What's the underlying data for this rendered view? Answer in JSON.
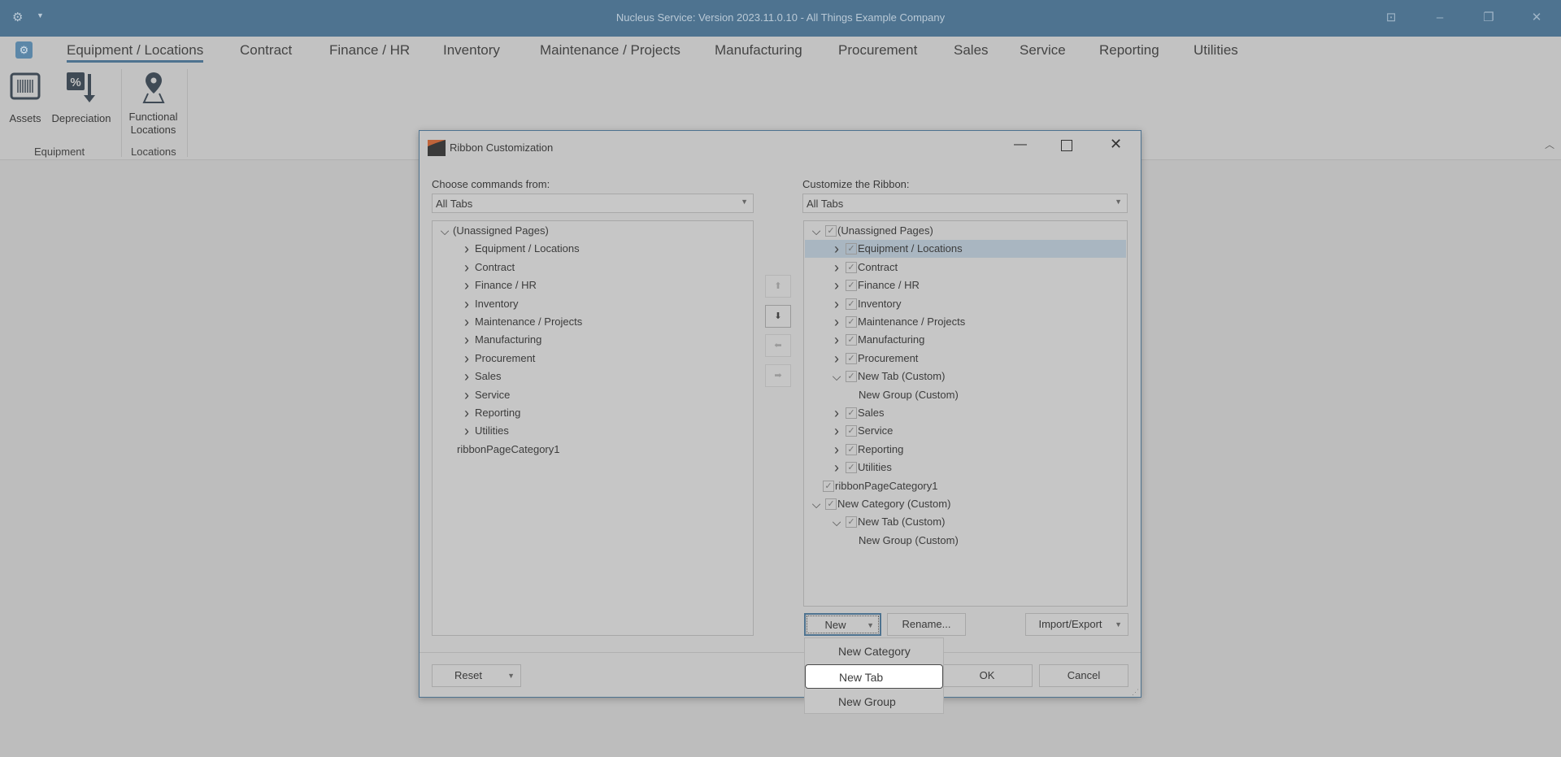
{
  "app": {
    "title": "Nucleus Service: Version 2023.11.0.10 - All Things Example Company"
  },
  "tabs": [
    "Equipment / Locations",
    "Contract",
    "Finance / HR",
    "Inventory",
    "Maintenance / Projects",
    "Manufacturing",
    "Procurement",
    "Sales",
    "Service",
    "Reporting",
    "Utilities"
  ],
  "ribbon": {
    "assets": "Assets",
    "depreciation": "Depreciation",
    "functional_locations": "Functional Locations",
    "group_equipment": "Equipment",
    "group_locations": "Locations"
  },
  "dialog": {
    "title": "Ribbon Customization",
    "left_label": "Choose commands from:",
    "left_combo": "All Tabs",
    "right_label": "Customize the Ribbon:",
    "right_combo": "All Tabs",
    "left_tree": [
      {
        "label": "(Unassigned Pages)",
        "level": 0,
        "chevron": "down"
      },
      {
        "label": "Equipment / Locations",
        "level": 1,
        "chevron": "right"
      },
      {
        "label": "Contract",
        "level": 1,
        "chevron": "right"
      },
      {
        "label": "Finance / HR",
        "level": 1,
        "chevron": "right"
      },
      {
        "label": "Inventory",
        "level": 1,
        "chevron": "right"
      },
      {
        "label": "Maintenance / Projects",
        "level": 1,
        "chevron": "right"
      },
      {
        "label": "Manufacturing",
        "level": 1,
        "chevron": "right"
      },
      {
        "label": "Procurement",
        "level": 1,
        "chevron": "right"
      },
      {
        "label": "Sales",
        "level": 1,
        "chevron": "right"
      },
      {
        "label": "Service",
        "level": 1,
        "chevron": "right"
      },
      {
        "label": "Reporting",
        "level": 1,
        "chevron": "right"
      },
      {
        "label": "Utilities",
        "level": 1,
        "chevron": "right"
      },
      {
        "label": "ribbonPageCategory1",
        "level": 1,
        "chevron": ""
      }
    ],
    "right_tree": [
      {
        "label": "(Unassigned Pages)",
        "level": 0,
        "chevron": "down",
        "checked": true
      },
      {
        "label": "Equipment / Locations",
        "level": 1,
        "chevron": "right",
        "checked": true,
        "selected": true
      },
      {
        "label": "Contract",
        "level": 1,
        "chevron": "right",
        "checked": true
      },
      {
        "label": "Finance / HR",
        "level": 1,
        "chevron": "right",
        "checked": true
      },
      {
        "label": "Inventory",
        "level": 1,
        "chevron": "right",
        "checked": true
      },
      {
        "label": "Maintenance / Projects",
        "level": 1,
        "chevron": "right",
        "checked": true
      },
      {
        "label": "Manufacturing",
        "level": 1,
        "chevron": "right",
        "checked": true
      },
      {
        "label": "Procurement",
        "level": 1,
        "chevron": "right",
        "checked": true
      },
      {
        "label": "New Tab (Custom)",
        "level": 1,
        "chevron": "down",
        "checked": true
      },
      {
        "label": "New Group (Custom)",
        "level": 2,
        "chevron": "",
        "checked": null
      },
      {
        "label": "Sales",
        "level": 1,
        "chevron": "right",
        "checked": true
      },
      {
        "label": "Service",
        "level": 1,
        "chevron": "right",
        "checked": true
      },
      {
        "label": "Reporting",
        "level": 1,
        "chevron": "right",
        "checked": true
      },
      {
        "label": "Utilities",
        "level": 1,
        "chevron": "right",
        "checked": true
      },
      {
        "label": "ribbonPageCategory1",
        "level": 0,
        "chevron": "",
        "checked": true
      },
      {
        "label": "New Category (Custom)",
        "level": 0,
        "chevron": "down",
        "checked": true
      },
      {
        "label": "New Tab (Custom)",
        "level": 1,
        "chevron": "down",
        "checked": true
      },
      {
        "label": "New Group (Custom)",
        "level": 2,
        "chevron": "",
        "checked": null
      }
    ],
    "buttons": {
      "new": "New",
      "rename": "Rename...",
      "import_export": "Import/Export",
      "reset": "Reset",
      "ok": "OK",
      "cancel": "Cancel"
    },
    "new_menu": [
      "New Category",
      "New Tab",
      "New Group"
    ],
    "new_menu_highlighted": 1
  }
}
